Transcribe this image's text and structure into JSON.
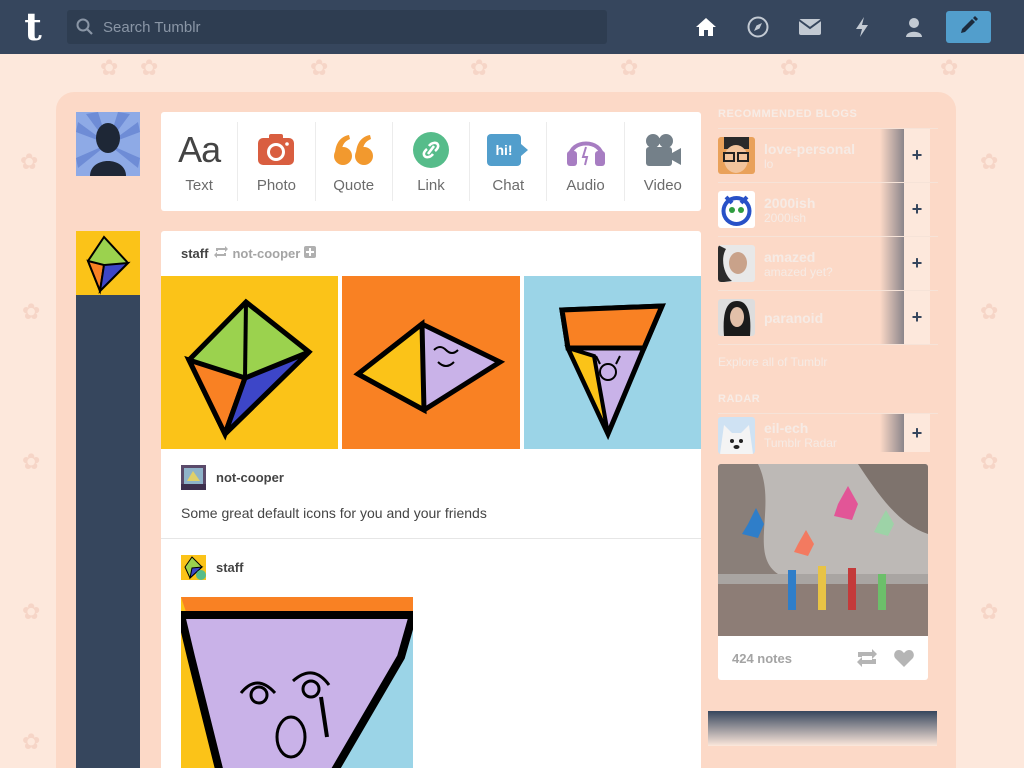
{
  "header": {
    "logo": "t",
    "search_placeholder": "Search Tumblr",
    "nav": [
      {
        "name": "home-icon"
      },
      {
        "name": "explore-icon"
      },
      {
        "name": "inbox-icon"
      },
      {
        "name": "activity-icon"
      },
      {
        "name": "account-icon"
      }
    ],
    "compose_icon": "pencil-icon"
  },
  "post_types": [
    {
      "label": "Text",
      "icon": "text-icon",
      "glyph": "Aa",
      "color": "#444444"
    },
    {
      "label": "Photo",
      "icon": "camera-icon",
      "color": "#d95e40"
    },
    {
      "label": "Quote",
      "icon": "quote-icon",
      "glyph": "“",
      "color": "#f2992e"
    },
    {
      "label": "Link",
      "icon": "link-icon",
      "color": "#56bc8a"
    },
    {
      "label": "Chat",
      "icon": "chat-icon",
      "glyph": "hi!",
      "color": "#529ecc"
    },
    {
      "label": "Audio",
      "icon": "headphones-icon",
      "color": "#a77dc2"
    },
    {
      "label": "Video",
      "icon": "video-camera-icon",
      "color": "#748089"
    }
  ],
  "post": {
    "blog": "staff",
    "reblogged_from": "not-cooper",
    "reblog_user": "not-cooper",
    "caption": "Some great default icons for you and your friends",
    "second_user": "staff",
    "colors": {
      "yellow": "#fbc318",
      "orange": "#f98123",
      "blue": "#9bd4e7",
      "purple": "#c9b2e8"
    }
  },
  "sidebar": {
    "recommended_heading": "RECOMMENDED BLOGS",
    "blogs": [
      {
        "name": "love-personal",
        "sub": "lo"
      },
      {
        "name": "2000ish",
        "sub": "2000ish"
      },
      {
        "name": "amazed",
        "sub": "amazed yet?"
      },
      {
        "name": "paranoid",
        "sub": ""
      }
    ],
    "explore": "Explore all of Tumblr",
    "radar_heading": "RADAR",
    "radar_blog": {
      "name": "eil-ech",
      "sub": "Tumblr Radar"
    },
    "radar_notes": "424 notes"
  }
}
